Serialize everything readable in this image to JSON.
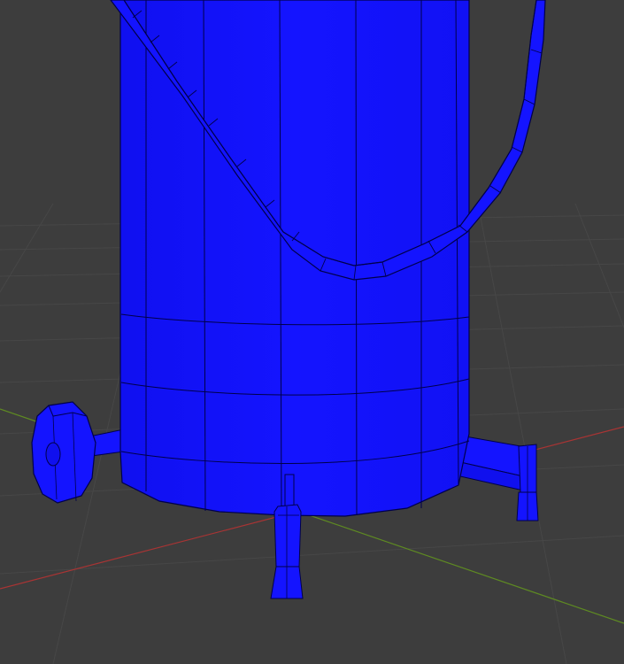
{
  "viewport": {
    "background": "#3d3d3d",
    "grid_color": "#4a4a4a",
    "x_axis_color": "#b23a3a",
    "y_axis_color": "#6f9a2a"
  },
  "model": {
    "fill_color": "#1414ff",
    "edge_color": "#00004a",
    "parts": [
      "cylinder-body",
      "bucket-handle",
      "side-wheel",
      "leg-front",
      "leg-right",
      "leg-back-small"
    ]
  }
}
